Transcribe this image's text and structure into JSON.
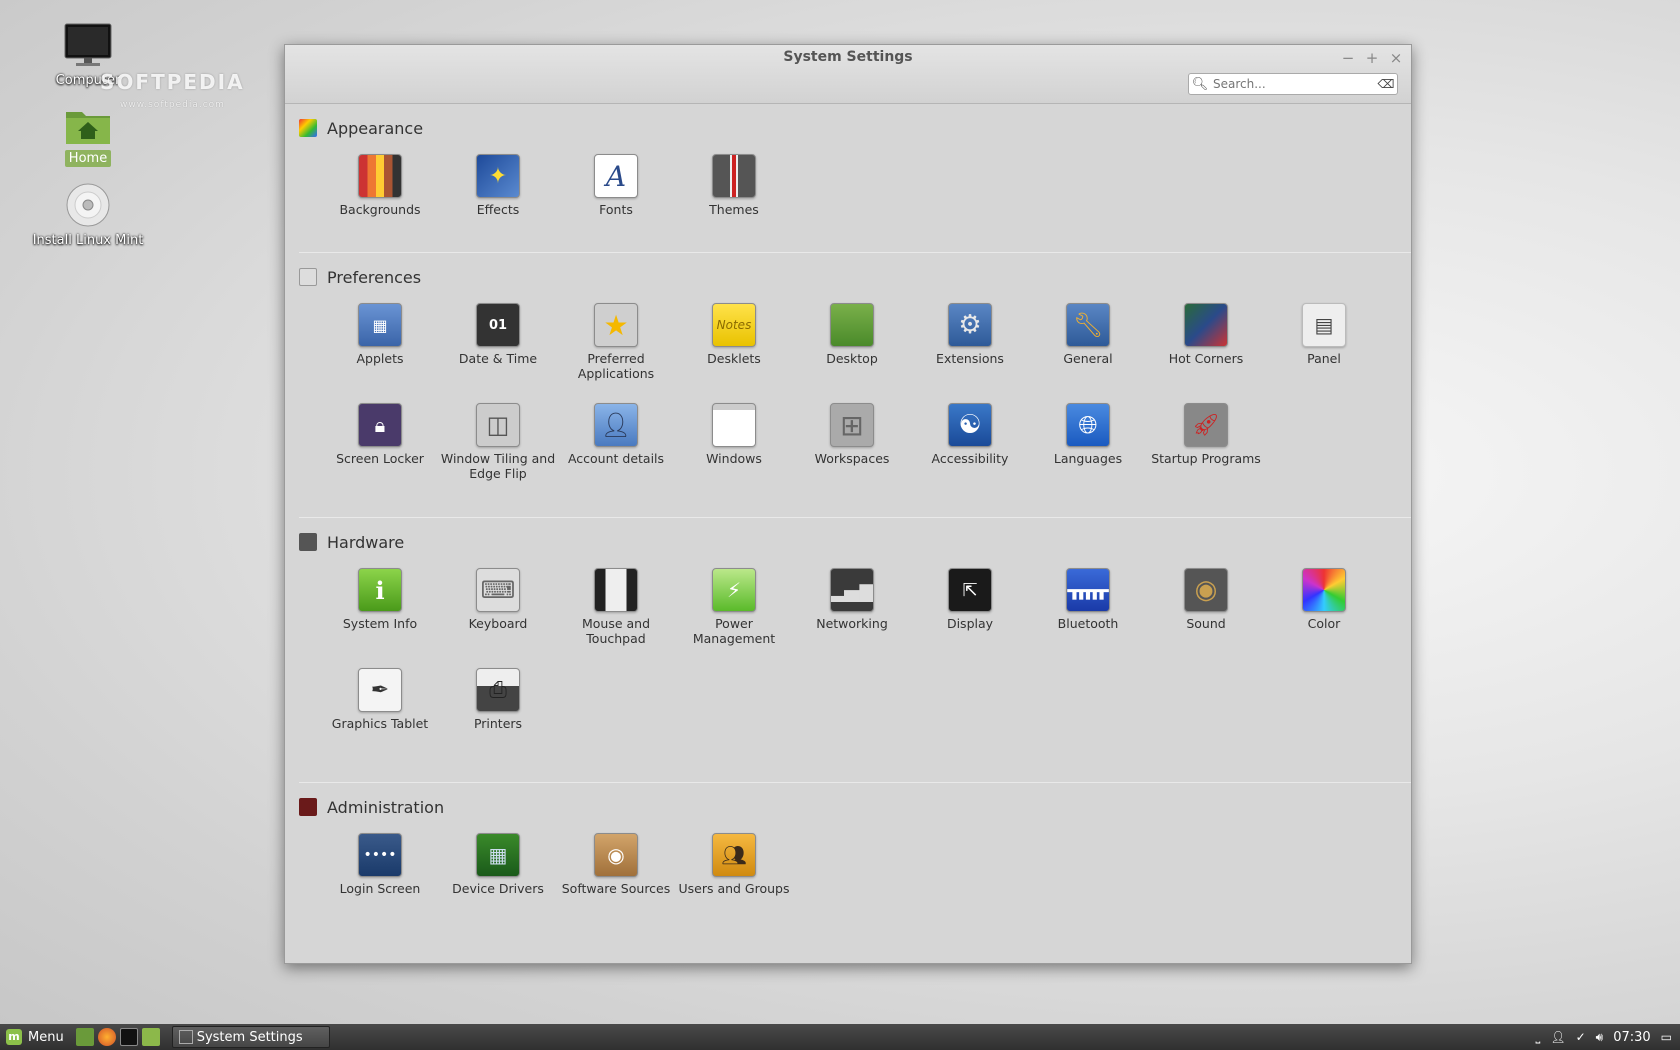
{
  "desktop": {
    "icons": [
      {
        "label": "Computer",
        "icon": "monitor-icon"
      },
      {
        "label": "Home",
        "icon": "home-folder-icon"
      },
      {
        "label": "Install Linux Mint",
        "icon": "cd-icon"
      }
    ],
    "watermark": "SOFTPEDIA",
    "watermark_url": "www.softpedia.com"
  },
  "window": {
    "title": "System Settings",
    "controls": {
      "minimize": "−",
      "maximize": "+",
      "close": "×"
    },
    "search_placeholder": "Search...",
    "sections": [
      {
        "title": "Appearance",
        "items": [
          "Backgrounds",
          "Effects",
          "Fonts",
          "Themes"
        ]
      },
      {
        "title": "Preferences",
        "items": [
          "Applets",
          "Date & Time",
          "Preferred Applications",
          "Desklets",
          "Desktop",
          "Extensions",
          "General",
          "Hot Corners",
          "Panel",
          "Screen Locker",
          "Window Tiling and Edge Flip",
          "Account details",
          "Windows",
          "Workspaces",
          "Accessibility",
          "Languages",
          "Startup Programs"
        ]
      },
      {
        "title": "Hardware",
        "items": [
          "System Info",
          "Keyboard",
          "Mouse and Touchpad",
          "Power Management",
          "Networking",
          "Display",
          "Bluetooth",
          "Sound",
          "Color",
          "Graphics Tablet",
          "Printers"
        ]
      },
      {
        "title": "Administration",
        "items": [
          "Login Screen",
          "Device Drivers",
          "Software Sources",
          "Users and Groups"
        ]
      }
    ]
  },
  "taskbar": {
    "menu_label": "Menu",
    "task_label": "System Settings",
    "clock": "07:30"
  }
}
